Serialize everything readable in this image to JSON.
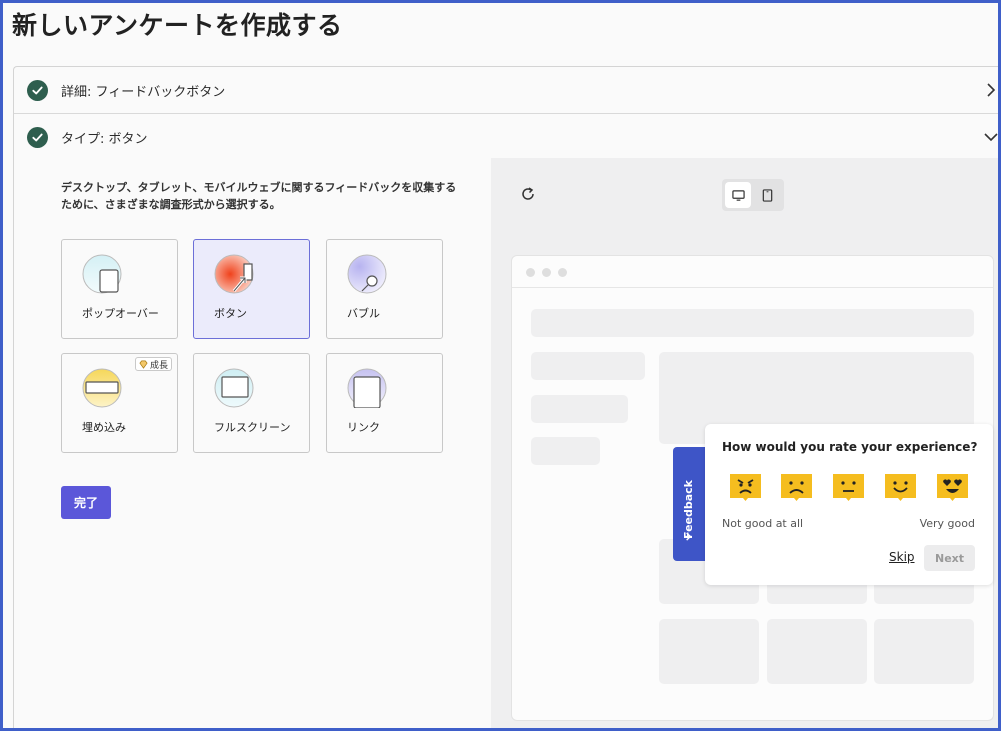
{
  "page": {
    "title": "新しいアンケートを作成する"
  },
  "accordion": {
    "details": {
      "label": "詳細: フィードバックボタン",
      "state": "completed",
      "icon": "chevron-right-icon"
    },
    "type": {
      "label": "タイプ: ボタン",
      "state": "completed",
      "icon": "chevron-down-icon"
    }
  },
  "type_section": {
    "description": "デスクトップ、タブレット、モバイルウェブに関するフィードバックを収集するために、さまざまな調査形式から選択する。",
    "options": [
      {
        "label": "ポップオーバー",
        "icon": "popover-icon",
        "selected": false
      },
      {
        "label": "ボタン",
        "icon": "button-icon",
        "selected": true
      },
      {
        "label": "バブル",
        "icon": "bubble-icon",
        "selected": false
      },
      {
        "label": "埋め込み",
        "icon": "embed-icon",
        "selected": false,
        "badge": "成長"
      },
      {
        "label": "フルスクリーン",
        "icon": "fullscreen-icon",
        "selected": false
      },
      {
        "label": "リンク",
        "icon": "link-icon",
        "selected": false
      }
    ],
    "done_label": "完了"
  },
  "preview": {
    "device": "desktop",
    "feedback_tab_label": "Feedback",
    "survey": {
      "question": "How would you rate your experience?",
      "scale_low": "Not good at all",
      "scale_high": "Very good",
      "faces": [
        "angry-face-icon",
        "sad-face-icon",
        "neutral-face-icon",
        "smile-face-icon",
        "love-face-icon"
      ],
      "skip_label": "Skip",
      "next_label": "Next"
    },
    "colors": {
      "feedback_tab": "#3e55c7",
      "face": "#f5bd1f",
      "done_button": "#5b57d9",
      "check": "#2e5e4e"
    }
  }
}
